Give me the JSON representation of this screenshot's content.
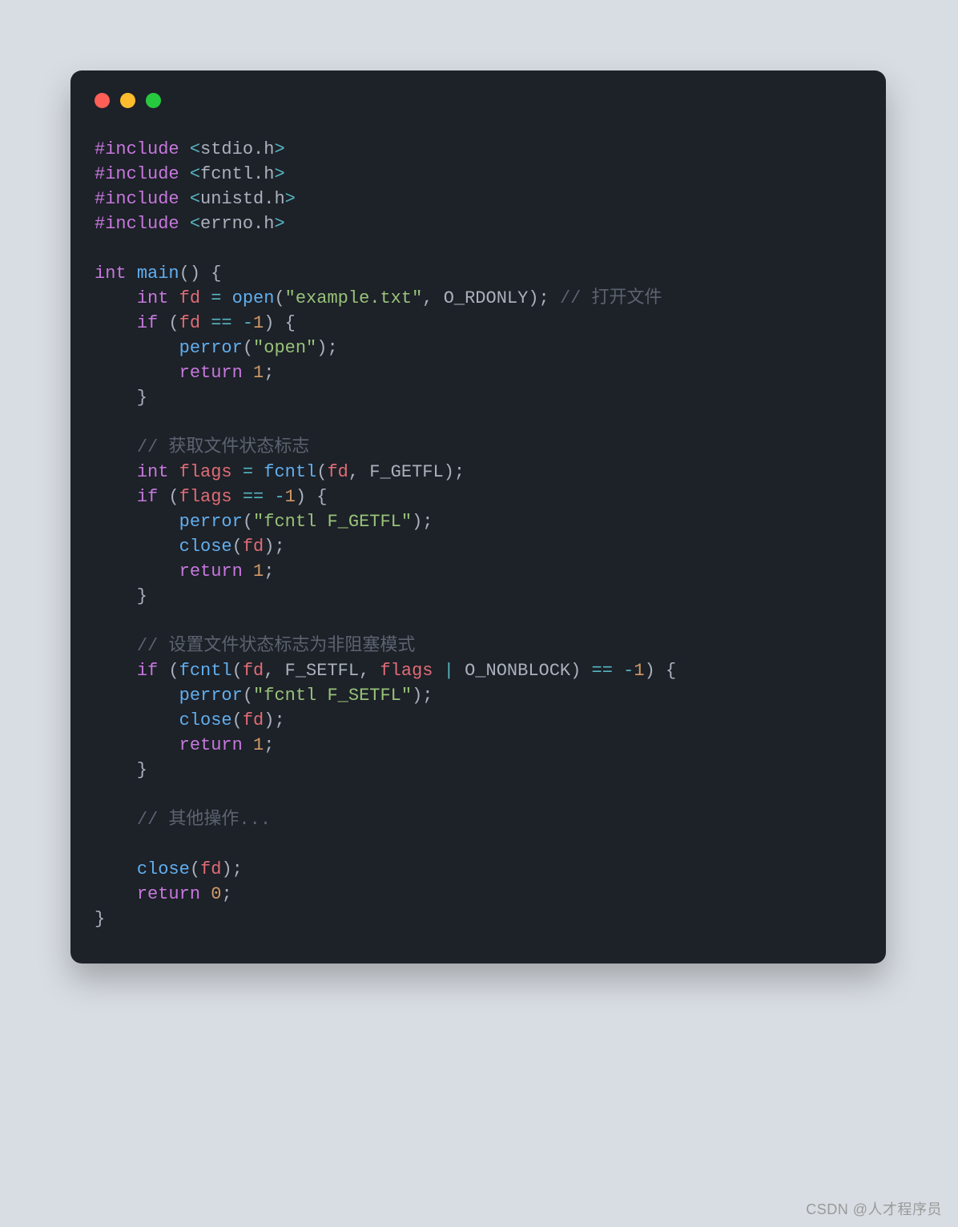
{
  "watermark": "CSDN @人才程序员",
  "code": {
    "tokens": [
      [
        [
          "pre",
          "#include"
        ],
        [
          "fg",
          " "
        ],
        [
          "op",
          "<"
        ],
        [
          "fg",
          "stdio.h"
        ],
        [
          "op",
          ">"
        ]
      ],
      [
        [
          "pre",
          "#include"
        ],
        [
          "fg",
          " "
        ],
        [
          "op",
          "<"
        ],
        [
          "fg",
          "fcntl.h"
        ],
        [
          "op",
          ">"
        ]
      ],
      [
        [
          "pre",
          "#include"
        ],
        [
          "fg",
          " "
        ],
        [
          "op",
          "<"
        ],
        [
          "fg",
          "unistd.h"
        ],
        [
          "op",
          ">"
        ]
      ],
      [
        [
          "pre",
          "#include"
        ],
        [
          "fg",
          " "
        ],
        [
          "op",
          "<"
        ],
        [
          "fg",
          "errno.h"
        ],
        [
          "op",
          ">"
        ]
      ],
      [],
      [
        [
          "type",
          "int"
        ],
        [
          "fg",
          " "
        ],
        [
          "fn",
          "main"
        ],
        [
          "fg",
          "() {"
        ]
      ],
      [
        [
          "fg",
          "    "
        ],
        [
          "type",
          "int"
        ],
        [
          "fg",
          " "
        ],
        [
          "id",
          "fd"
        ],
        [
          "fg",
          " "
        ],
        [
          "op",
          "="
        ],
        [
          "fg",
          " "
        ],
        [
          "fn",
          "open"
        ],
        [
          "fg",
          "("
        ],
        [
          "str",
          "\"example.txt\""
        ],
        [
          "fg",
          ", O_RDONLY); "
        ],
        [
          "cm",
          "// 打开文件"
        ]
      ],
      [
        [
          "fg",
          "    "
        ],
        [
          "kw",
          "if"
        ],
        [
          "fg",
          " ("
        ],
        [
          "id",
          "fd"
        ],
        [
          "fg",
          " "
        ],
        [
          "op",
          "=="
        ],
        [
          "fg",
          " "
        ],
        [
          "op",
          "-"
        ],
        [
          "num",
          "1"
        ],
        [
          "fg",
          ") {"
        ]
      ],
      [
        [
          "fg",
          "        "
        ],
        [
          "fn",
          "perror"
        ],
        [
          "fg",
          "("
        ],
        [
          "str",
          "\"open\""
        ],
        [
          "fg",
          ");"
        ]
      ],
      [
        [
          "fg",
          "        "
        ],
        [
          "kw",
          "return"
        ],
        [
          "fg",
          " "
        ],
        [
          "num",
          "1"
        ],
        [
          "fg",
          ";"
        ]
      ],
      [
        [
          "fg",
          "    }"
        ]
      ],
      [],
      [
        [
          "fg",
          "    "
        ],
        [
          "cm",
          "// 获取文件状态标志"
        ]
      ],
      [
        [
          "fg",
          "    "
        ],
        [
          "type",
          "int"
        ],
        [
          "fg",
          " "
        ],
        [
          "id",
          "flags"
        ],
        [
          "fg",
          " "
        ],
        [
          "op",
          "="
        ],
        [
          "fg",
          " "
        ],
        [
          "fn",
          "fcntl"
        ],
        [
          "fg",
          "("
        ],
        [
          "id",
          "fd"
        ],
        [
          "fg",
          ", F_GETFL);"
        ]
      ],
      [
        [
          "fg",
          "    "
        ],
        [
          "kw",
          "if"
        ],
        [
          "fg",
          " ("
        ],
        [
          "id",
          "flags"
        ],
        [
          "fg",
          " "
        ],
        [
          "op",
          "=="
        ],
        [
          "fg",
          " "
        ],
        [
          "op",
          "-"
        ],
        [
          "num",
          "1"
        ],
        [
          "fg",
          ") {"
        ]
      ],
      [
        [
          "fg",
          "        "
        ],
        [
          "fn",
          "perror"
        ],
        [
          "fg",
          "("
        ],
        [
          "str",
          "\"fcntl F_GETFL\""
        ],
        [
          "fg",
          ");"
        ]
      ],
      [
        [
          "fg",
          "        "
        ],
        [
          "fn",
          "close"
        ],
        [
          "fg",
          "("
        ],
        [
          "id",
          "fd"
        ],
        [
          "fg",
          ");"
        ]
      ],
      [
        [
          "fg",
          "        "
        ],
        [
          "kw",
          "return"
        ],
        [
          "fg",
          " "
        ],
        [
          "num",
          "1"
        ],
        [
          "fg",
          ";"
        ]
      ],
      [
        [
          "fg",
          "    }"
        ]
      ],
      [],
      [
        [
          "fg",
          "    "
        ],
        [
          "cm",
          "// 设置文件状态标志为非阻塞模式"
        ]
      ],
      [
        [
          "fg",
          "    "
        ],
        [
          "kw",
          "if"
        ],
        [
          "fg",
          " ("
        ],
        [
          "fn",
          "fcntl"
        ],
        [
          "fg",
          "("
        ],
        [
          "id",
          "fd"
        ],
        [
          "fg",
          ", F_SETFL, "
        ],
        [
          "id",
          "flags"
        ],
        [
          "fg",
          " "
        ],
        [
          "op",
          "|"
        ],
        [
          "fg",
          " O_NONBLOCK) "
        ],
        [
          "op",
          "=="
        ],
        [
          "fg",
          " "
        ],
        [
          "op",
          "-"
        ],
        [
          "num",
          "1"
        ],
        [
          "fg",
          ") {"
        ]
      ],
      [
        [
          "fg",
          "        "
        ],
        [
          "fn",
          "perror"
        ],
        [
          "fg",
          "("
        ],
        [
          "str",
          "\"fcntl F_SETFL\""
        ],
        [
          "fg",
          ");"
        ]
      ],
      [
        [
          "fg",
          "        "
        ],
        [
          "fn",
          "close"
        ],
        [
          "fg",
          "("
        ],
        [
          "id",
          "fd"
        ],
        [
          "fg",
          ");"
        ]
      ],
      [
        [
          "fg",
          "        "
        ],
        [
          "kw",
          "return"
        ],
        [
          "fg",
          " "
        ],
        [
          "num",
          "1"
        ],
        [
          "fg",
          ";"
        ]
      ],
      [
        [
          "fg",
          "    }"
        ]
      ],
      [],
      [
        [
          "fg",
          "    "
        ],
        [
          "cm",
          "// 其他操作..."
        ]
      ],
      [],
      [
        [
          "fg",
          "    "
        ],
        [
          "fn",
          "close"
        ],
        [
          "fg",
          "("
        ],
        [
          "id",
          "fd"
        ],
        [
          "fg",
          ");"
        ]
      ],
      [
        [
          "fg",
          "    "
        ],
        [
          "kw",
          "return"
        ],
        [
          "fg",
          " "
        ],
        [
          "num",
          "0"
        ],
        [
          "fg",
          ";"
        ]
      ],
      [
        [
          "fg",
          "}"
        ]
      ]
    ]
  }
}
